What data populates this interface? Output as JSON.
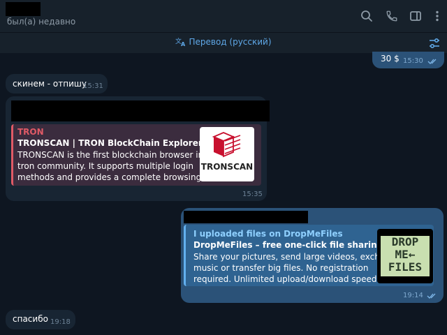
{
  "header": {
    "status": "был(а) недавно",
    "icons": [
      "search-icon",
      "phone-icon",
      "sidebar-toggle-icon",
      "more-vertical-icon"
    ]
  },
  "translation": {
    "label": "Перевод (русский)",
    "icons": [
      "translate-icon",
      "filter-settings-icon"
    ]
  },
  "messages": [
    {
      "direction": "out",
      "text": "30 $",
      "time": "15:30",
      "read": true
    },
    {
      "direction": "in",
      "text": "скинем - отпишу",
      "time": "15:31"
    },
    {
      "direction": "in",
      "time": "15:35",
      "link_preview": {
        "site": "TRON",
        "title": "TRONSCAN | TRON BlockChain Explorer",
        "description_lines": [
          "TRONSCAN is the first blockchain browser in the",
          "tron community. It supports multiple login",
          "methods and provides a complete browsing an..."
        ],
        "thumbnail_text": "TRONSCAN"
      }
    },
    {
      "direction": "out",
      "time": "19:14",
      "read": true,
      "link_preview": {
        "site": "I uploaded files on DropMeFiles",
        "title": "DropMeFiles – free one-click file sharing service",
        "description_lines": [
          "Share your pictures, send large videos, exchange",
          "music or transfer big files. No registration",
          "required. Unlimited upload/download speed."
        ],
        "thumbnail_lines": [
          "DROP",
          "ME",
          "FILES"
        ]
      }
    },
    {
      "direction": "in",
      "text": "спасибо",
      "time": "19:18"
    }
  ],
  "colors": {
    "background": "#0e1621",
    "header": "#17212b",
    "incoming_bubble": "#182533",
    "outgoing_bubble": "#2b5278",
    "accent": "#5fa8e8",
    "tron_red": "#e05a66"
  }
}
